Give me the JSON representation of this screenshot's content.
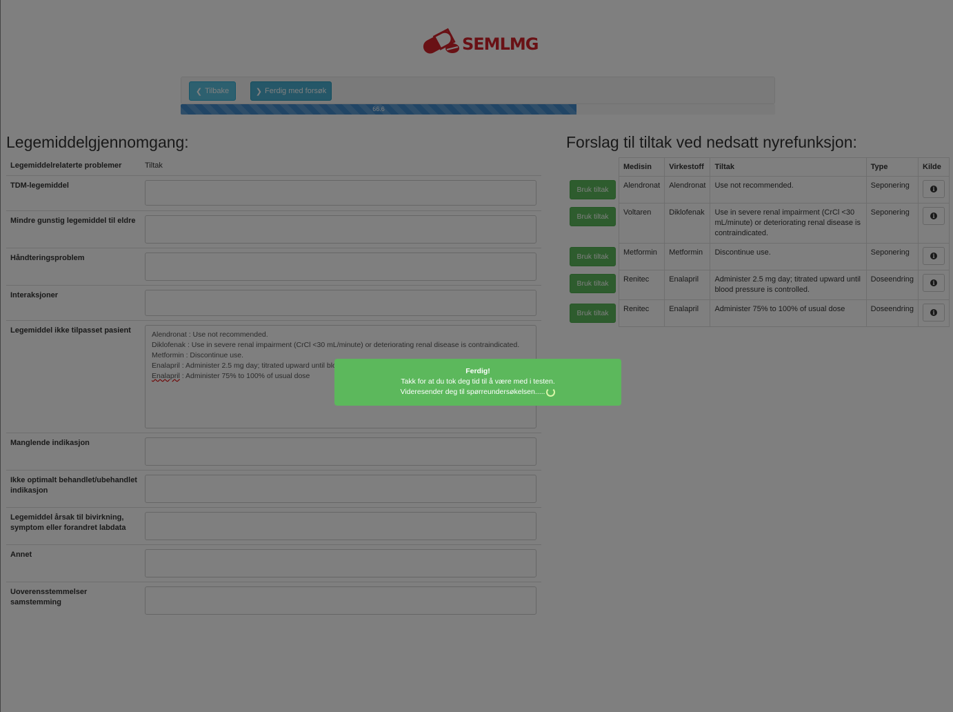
{
  "app": {
    "logo_text": "SEMLMG"
  },
  "toolbar": {
    "back_label": "Tilbake",
    "done_label": "Ferdig med forsøk",
    "progress_percent": 66.6,
    "progress_label": "66.6"
  },
  "left": {
    "title": "Legemiddelgjennomgang:",
    "col_problem": "Legemiddelrelaterte problemer",
    "col_tiltak": "Tiltak",
    "rows": [
      {
        "label": "TDM-legemiddel",
        "value": ""
      },
      {
        "label": "Mindre gunstig legemiddel til eldre",
        "value": ""
      },
      {
        "label": "Håndteringsproblem",
        "value": ""
      },
      {
        "label": "Interaksjoner",
        "value": ""
      },
      {
        "label": "Legemiddel ikke tilpasset pasient",
        "value": "Alendronat : Use not recommended.\nDiklofenak : Use in severe renal impairment (CrCl <30 mL/minute) or deteriorating renal disease is contraindicated.\nMetformin : Discontinue use.\nEnalapril : Administer 2.5 mg day; titrated upward until blood pressure is controlled.\nEnalapril : Administer 75% to 100% of usual dose"
      },
      {
        "label": "Manglende indikasjon",
        "value": ""
      },
      {
        "label": "Ikke optimalt behandlet/ubehandlet indikasjon",
        "value": ""
      },
      {
        "label": "Legemiddel årsak til bivirkning, symptom eller forandret labdata",
        "value": ""
      },
      {
        "label": "Annet",
        "value": ""
      },
      {
        "label": "Uoverensstemmelser samstemming",
        "value": ""
      }
    ]
  },
  "right": {
    "title": "Forslag til tiltak ved nedsatt nyrefunksjon:",
    "headers": {
      "medisin": "Medisin",
      "virkestoff": "Virkestoff",
      "tiltak": "Tiltak",
      "type": "Type",
      "kilde": "Kilde"
    },
    "use_button_label": "Bruk tiltak",
    "rows": [
      {
        "medisin": "Alendronat",
        "virkestoff": "Alendronat",
        "tiltak": "Use not recommended.",
        "type": "Seponering"
      },
      {
        "medisin": "Voltaren",
        "virkestoff": "Diklofenak",
        "tiltak": "Use in severe renal impairment (CrCl <30 mL/minute) or deteriorating renal disease is contraindicated.",
        "type": "Seponering"
      },
      {
        "medisin": "Metformin",
        "virkestoff": "Metformin",
        "tiltak": "Discontinue use.",
        "type": "Seponering"
      },
      {
        "medisin": "Renitec",
        "virkestoff": "Enalapril",
        "tiltak": "Administer 2.5 mg day; titrated upward until blood pressure is controlled.",
        "type": "Doseendring"
      },
      {
        "medisin": "Renitec",
        "virkestoff": "Enalapril",
        "tiltak": "Administer 75% to 100% of usual dose",
        "type": "Doseendring"
      }
    ]
  },
  "notification": {
    "title": "Ferdig!",
    "line1": "Takk for at du tok deg tid til å være med i testen.",
    "line2": "Videresender deg til spørreundersøkelsen....."
  },
  "colors": {
    "brand": "#d2222a",
    "success": "#5cb85c",
    "info": "#5bc0de",
    "progress": "#428bca"
  }
}
